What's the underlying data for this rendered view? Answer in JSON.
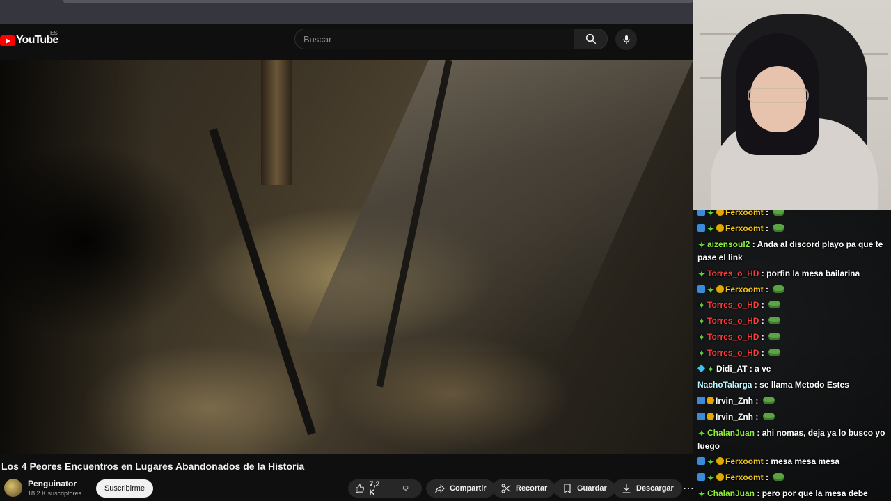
{
  "browser": {
    "tab_hint": ""
  },
  "youtube": {
    "logo_text": "YouTube",
    "country_code": "ES",
    "search_placeholder": "Buscar",
    "video": {
      "title": "Los 4 Peores Encuentros en Lugares Abandonados de la Historia",
      "channel_name": "Penguinator",
      "subscribers": "18,2 K suscriptores",
      "subscribe_label": "Suscribirme",
      "likes": "7,2 K",
      "share_label": "Compartir",
      "clip_label": "Recortar",
      "save_label": "Guardar",
      "download_label": "Descargar"
    }
  },
  "chat": {
    "messages": [
      {
        "badges": [
          "mod",
          "plus",
          "coin"
        ],
        "user": "Ferxoomt",
        "color": "#f5c518",
        "text": "",
        "emote": true
      },
      {
        "badges": [
          "mod",
          "plus",
          "coin"
        ],
        "user": "Ferxoomt",
        "color": "#f5c518",
        "text": "",
        "emote": true
      },
      {
        "badges": [
          "plus"
        ],
        "user": "aizensoul2",
        "color": "#8ef03a",
        "text": "Anda al discord playo pa que te pase el link",
        "emote": false
      },
      {
        "badges": [
          "plus"
        ],
        "user": "Torres_o_HD",
        "color": "#ff3c3c",
        "text": "porfin la mesa bailarina",
        "emote": false
      },
      {
        "badges": [
          "mod",
          "plus",
          "coin"
        ],
        "user": "Ferxoomt",
        "color": "#f5c518",
        "text": "",
        "emote": true
      },
      {
        "badges": [
          "plus"
        ],
        "user": "Torres_o_HD",
        "color": "#ff3c3c",
        "text": "",
        "emote": true
      },
      {
        "badges": [
          "plus"
        ],
        "user": "Torres_o_HD",
        "color": "#ff3c3c",
        "text": "",
        "emote": true
      },
      {
        "badges": [
          "plus"
        ],
        "user": "Torres_o_HD",
        "color": "#ff3c3c",
        "text": "",
        "emote": true
      },
      {
        "badges": [
          "plus"
        ],
        "user": "Torres_o_HD",
        "color": "#ff3c3c",
        "text": "",
        "emote": true
      },
      {
        "badges": [
          "gem",
          "plus"
        ],
        "user": "Didi_AT",
        "color": "#ffffff",
        "text": "a ve",
        "emote": false
      },
      {
        "badges": [],
        "user": "NachoTalarga",
        "color": "#b9f6ff",
        "text": "se llama Metodo Estes",
        "emote": false
      },
      {
        "badges": [
          "mod",
          "coin"
        ],
        "user": "Irvin_Znh",
        "color": "#ffffff",
        "text": "",
        "emote": true
      },
      {
        "badges": [
          "mod",
          "coin"
        ],
        "user": "Irvin_Znh",
        "color": "#ffffff",
        "text": "",
        "emote": true
      },
      {
        "badges": [
          "plus"
        ],
        "user": "ChalanJuan",
        "color": "#8ef03a",
        "text": "ahi nomas, deja ya lo busco yo luego",
        "emote": false
      },
      {
        "badges": [
          "mod",
          "plus",
          "coin"
        ],
        "user": "Ferxoomt",
        "color": "#f5c518",
        "text": "mesa mesa mesa",
        "emote": false
      },
      {
        "badges": [
          "mod",
          "plus",
          "coin"
        ],
        "user": "Ferxoomt",
        "color": "#f5c518",
        "text": "",
        "emote": true
      },
      {
        "badges": [
          "plus"
        ],
        "user": "ChalanJuan",
        "color": "#8ef03a",
        "text": "pero por que la mesa debe girar?",
        "emote": false
      }
    ]
  }
}
